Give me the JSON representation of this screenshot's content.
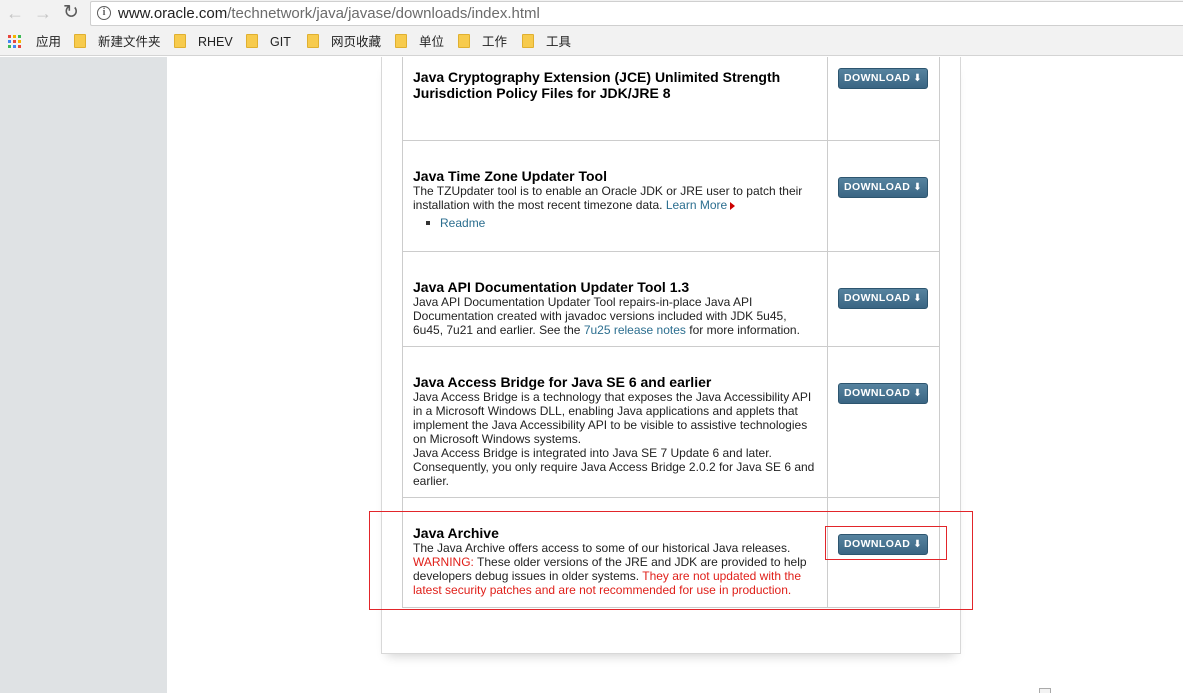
{
  "browser": {
    "url_host": "www.oracle.com",
    "url_path": "/technetwork/java/javase/downloads/index.html",
    "bookmarks": [
      {
        "label": "应用"
      },
      {
        "label": "新建文件夹"
      },
      {
        "label": "RHEV"
      },
      {
        "label": "GIT"
      },
      {
        "label": "网页收藏"
      },
      {
        "label": "单位"
      },
      {
        "label": "工作"
      },
      {
        "label": "工具"
      }
    ]
  },
  "download_label": "DOWNLOAD",
  "rows": [
    {
      "title": "Java Cryptography Extension (JCE) Unlimited Strength",
      "title_line2": "Jurisdiction Policy Files for JDK/JRE 8"
    },
    {
      "title": "Java Time Zone Updater Tool",
      "text": "The TZUpdater tool is to enable an Oracle JDK or JRE user to patch their installation with the most recent timezone data.",
      "link": "Learn More",
      "sub_link": "Readme"
    },
    {
      "title": "Java API Documentation Updater Tool 1.3",
      "text": "Java API Documentation Updater Tool repairs-in-place Java API Documentation created with javadoc versions included with JDK 5u45, 6u45, 7u21 and earlier.  See the",
      "link": "7u25 release notes",
      "text_after": "for more information."
    },
    {
      "title": "Java Access Bridge for Java SE 6 and earlier",
      "text": "Java Access Bridge is a technology that exposes the Java Accessibility API in a Microsoft Windows DLL, enabling Java applications and applets that implement the Java Accessibility API to be visible to assistive technologies on Microsoft Windows systems.",
      "text2": "Java Access Bridge is integrated into Java SE 7 Update 6 and later. Consequently, you only require Java Access Bridge 2.0.2 for Java SE 6 and earlier."
    },
    {
      "title": "Java Archive",
      "text": "The Java Archive offers access to some of our historical Java releases.",
      "warning_label": "WARNING:",
      "warning_text": "These older versions of the JRE and JDK are provided to help developers debug issues in older systems.",
      "warning_red": "They are not updated with the latest security patches and are not recommended for use in production."
    }
  ],
  "colors": {
    "button": "#3f6b89",
    "link": "#2b6e8f",
    "warning": "#e0201a",
    "highlight": "#e2252a"
  }
}
